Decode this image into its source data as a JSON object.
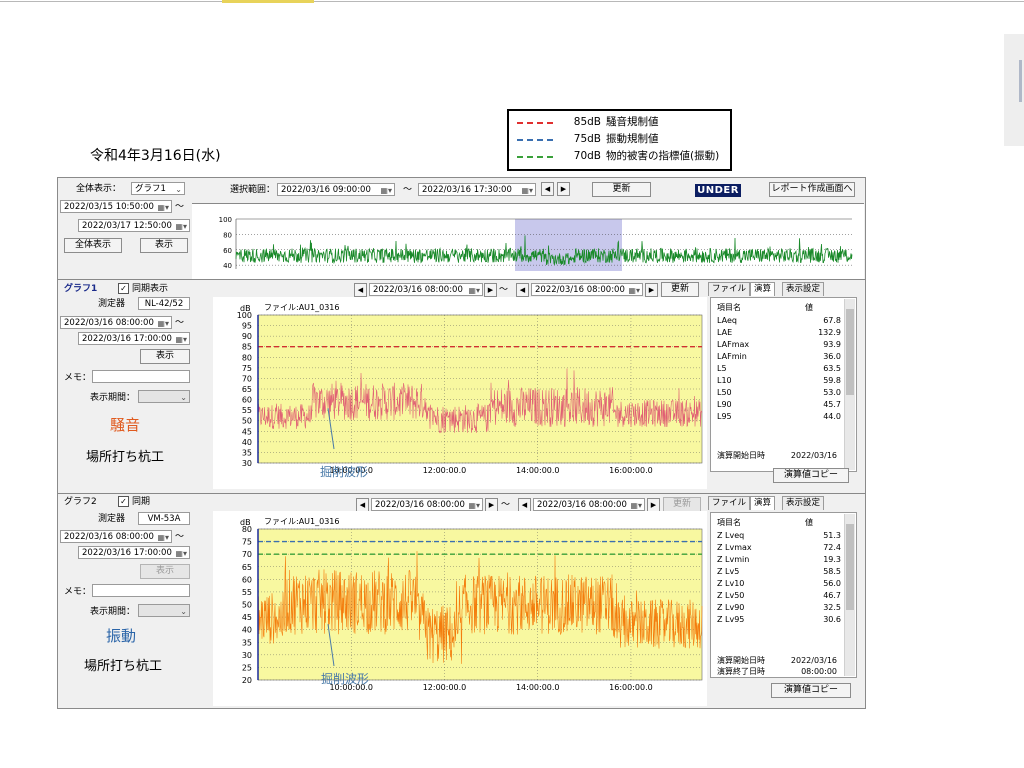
{
  "page": {
    "date": "令和4年3月16日(水)"
  },
  "legend": [
    {
      "value": "85dB",
      "label": "騒音規制値",
      "color": "#e03030"
    },
    {
      "value": "75dB",
      "label": "振動規制値",
      "color": "#3a6fb0"
    },
    {
      "value": "70dB",
      "label": "物的被害の指標値(振動)",
      "color": "#3aa03a"
    }
  ],
  "overview": {
    "display_label": "全体表示：",
    "display_select": "グラフ1",
    "range_label": "選択範囲：",
    "range_start": "2022/03/16 09:00:00",
    "range_sep": "～",
    "range_end": "2022/03/16 17:30:00",
    "update_button": "更新",
    "status_badge": "UNDER",
    "report_button": "レポート作成画面へ",
    "from_datetime": "2022/03/15 10:50:00",
    "to_datetime": "2022/03/17 12:50:00",
    "tilde": "～",
    "show_all_button": "全体表示",
    "show_button": "表示",
    "mini_chart": {
      "type": "line",
      "y_ticks": [
        "100",
        "80",
        "60",
        "40"
      ],
      "ylim": [
        35,
        100
      ],
      "color": "#1a8a2a"
    }
  },
  "graph1": {
    "title": "グラフ1",
    "sync_label": "同期表示",
    "sync_checked": true,
    "device_label": "測定器",
    "device_value": "NL-42/52",
    "start": "2022/03/16 08:00:00",
    "tilde": "～",
    "end": "2022/03/16 17:00:00",
    "show_button": "表示",
    "memo_label": "メモ：",
    "memo_value": "",
    "period_label": "表示期間：",
    "period_value": "",
    "kind_label": "騒音",
    "work_label": "場所打ち杭工",
    "annotation": "掘削波形",
    "toolbar": {
      "start": "2022/03/16 08:00:00",
      "sep": "～",
      "end": "2022/03/16 08:00:00",
      "update_button": "更新"
    },
    "tabs": [
      "ファイル",
      "演算",
      "表示設定"
    ],
    "table_header": {
      "name": "項目名",
      "value": "値"
    },
    "rows": [
      {
        "name": "LAeq",
        "value": "67.8"
      },
      {
        "name": "LAE",
        "value": "132.9"
      },
      {
        "name": "LAFmax",
        "value": "93.9"
      },
      {
        "name": "LAFmin",
        "value": "36.0"
      },
      {
        "name": "L5",
        "value": "63.5"
      },
      {
        "name": "L10",
        "value": "59.8"
      },
      {
        "name": "L50",
        "value": "53.0"
      },
      {
        "name": "L90",
        "value": "45.7"
      },
      {
        "name": "L95",
        "value": "44.0"
      }
    ],
    "start_label": "演算開始日時",
    "start_value": "2022/03/16",
    "copy_button": "演算値コピー"
  },
  "graph2": {
    "title": "グラフ2",
    "sync_label": "同期",
    "sync_checked": true,
    "device_label": "測定器",
    "device_value": "VM-53A",
    "start": "2022/03/16 08:00:00",
    "tilde": "～",
    "end": "2022/03/16 17:00:00",
    "show_button": "表示",
    "memo_label": "メモ：",
    "memo_value": "",
    "period_label": "表示期間：",
    "period_value": "",
    "kind_label": "振動",
    "work_label": "場所打ち杭工",
    "annotation": "掘削波形",
    "toolbar": {
      "start": "2022/03/16 08:00:00",
      "sep": "～",
      "end": "2022/03/16 08:00:00",
      "update_button": "更新"
    },
    "tabs": [
      "ファイル",
      "演算",
      "表示設定"
    ],
    "table_header": {
      "name": "項目名",
      "value": "値"
    },
    "rows": [
      {
        "name": "Z Lveq",
        "value": "51.3"
      },
      {
        "name": "Z Lvmax",
        "value": "72.4"
      },
      {
        "name": "Z Lvmin",
        "value": "19.3"
      },
      {
        "name": "Z Lv5",
        "value": "58.5"
      },
      {
        "name": "Z Lv10",
        "value": "56.0"
      },
      {
        "name": "Z Lv50",
        "value": "46.7"
      },
      {
        "name": "Z Lv90",
        "value": "32.5"
      },
      {
        "name": "Z Lv95",
        "value": "30.6"
      }
    ],
    "start_label": "演算開始日時",
    "start_value": "2022/03/16",
    "end_label": "演算終了日時",
    "end_value": "08:00:00",
    "copy_button": "演算値コピー"
  },
  "chart_data": [
    {
      "type": "line",
      "ylabel": "dB",
      "file_label": "ファイル:AU1_0316",
      "y_ticks": [
        "100",
        "95",
        "90",
        "85",
        "80",
        "75",
        "70",
        "65",
        "60",
        "55",
        "50",
        "45",
        "40",
        "35",
        "30"
      ],
      "ylim": [
        30,
        100
      ],
      "x_ticks": [
        "10:00:00.0",
        "12:00:00.0",
        "14:00:00.0",
        "16:00:00.0"
      ],
      "series": [
        {
          "color": "#e06074",
          "typical_range": [
            47,
            64
          ]
        }
      ],
      "threshold": {
        "value": 85,
        "color": "#d03030"
      },
      "background": "#f8f8a0"
    },
    {
      "type": "line",
      "ylabel": "dB",
      "file_label": "ファイル:AU1_0316",
      "y_ticks": [
        "80",
        "75",
        "70",
        "65",
        "60",
        "55",
        "50",
        "45",
        "40",
        "35",
        "30",
        "25",
        "20"
      ],
      "ylim": [
        20,
        80
      ],
      "x_ticks": [
        "10:00:00.0",
        "12:00:00.0",
        "14:00:00.0",
        "16:00:00.0"
      ],
      "series": [
        {
          "color": "#f47c0c",
          "typical_range": [
            35,
            60
          ]
        }
      ],
      "thresholds": [
        {
          "value": 75,
          "color": "#3a6fb0"
        },
        {
          "value": 70,
          "color": "#3aa03a"
        }
      ],
      "background": "#f8f8a0"
    }
  ]
}
